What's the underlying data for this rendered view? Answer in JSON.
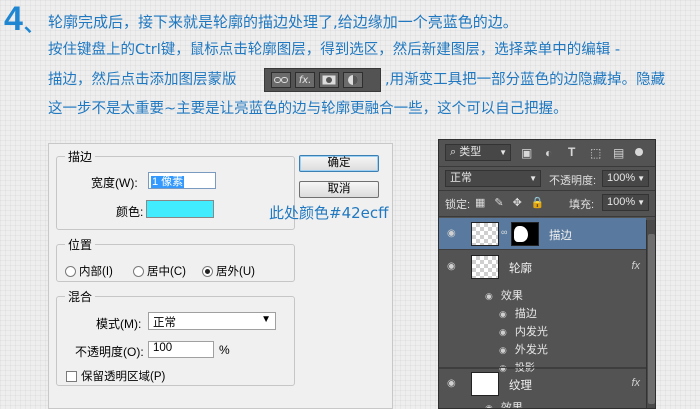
{
  "step": {
    "number": "4",
    "comma": "、",
    "lines": [
      "轮廓完成后，接下来就是轮廓的描边处理了,给边缘加一个亮蓝色的边。",
      "按住键盘上的Ctrl键，鼠标点击轮廓图层，得到选区，然后新建图层，选择菜单中的编辑 -",
      "描边，然后点击添加图层蒙版",
      ",用渐变工具把一部分蓝色的边隐藏掉。隐藏",
      "这一步不是太重要~主要是让亮蓝色的边与轮廓更融合一些，这个可以自己把握。"
    ],
    "toolbar_image": {
      "buttons": [
        "link-icon",
        "fx",
        "mask-icon",
        "adjustment-icon"
      ],
      "fx_label": "fx."
    }
  },
  "stroke_dialog": {
    "stroke_group": "描边",
    "width_label": "宽度(W):",
    "width_value": "1 像素",
    "color_label": "颜色:",
    "color_value": "#42ecff",
    "color_note": "此处颜色#42ecff",
    "position_group": "位置",
    "position_options": [
      "内部(I)",
      "居中(C)",
      "居外(U)"
    ],
    "position_selected": "居外(U)",
    "blend_group": "混合",
    "mode_label": "模式(M):",
    "mode_value": "正常",
    "opacity_label": "不透明度(O):",
    "opacity_value": "100",
    "opacity_unit": "%",
    "preserve_transparency": "保留透明区域(P)",
    "ok_button": "确定",
    "cancel_button": "取消"
  },
  "layers_panel": {
    "filter_label": "类型",
    "blend_mode": "正常",
    "opacity_label": "不透明度:",
    "opacity_value": "100%",
    "lock_label": "锁定:",
    "fill_label": "填充:",
    "fill_value": "100%",
    "layers": [
      {
        "name": "描边",
        "selected": true
      },
      {
        "name": "轮廓",
        "fx": "fx",
        "effects_label": "效果",
        "effects": [
          "描边",
          "内发光",
          "外发光",
          "投影"
        ]
      },
      {
        "name": "纹理",
        "fx": "fx",
        "effects_label": "效果"
      }
    ],
    "accent": "#597a9e"
  }
}
